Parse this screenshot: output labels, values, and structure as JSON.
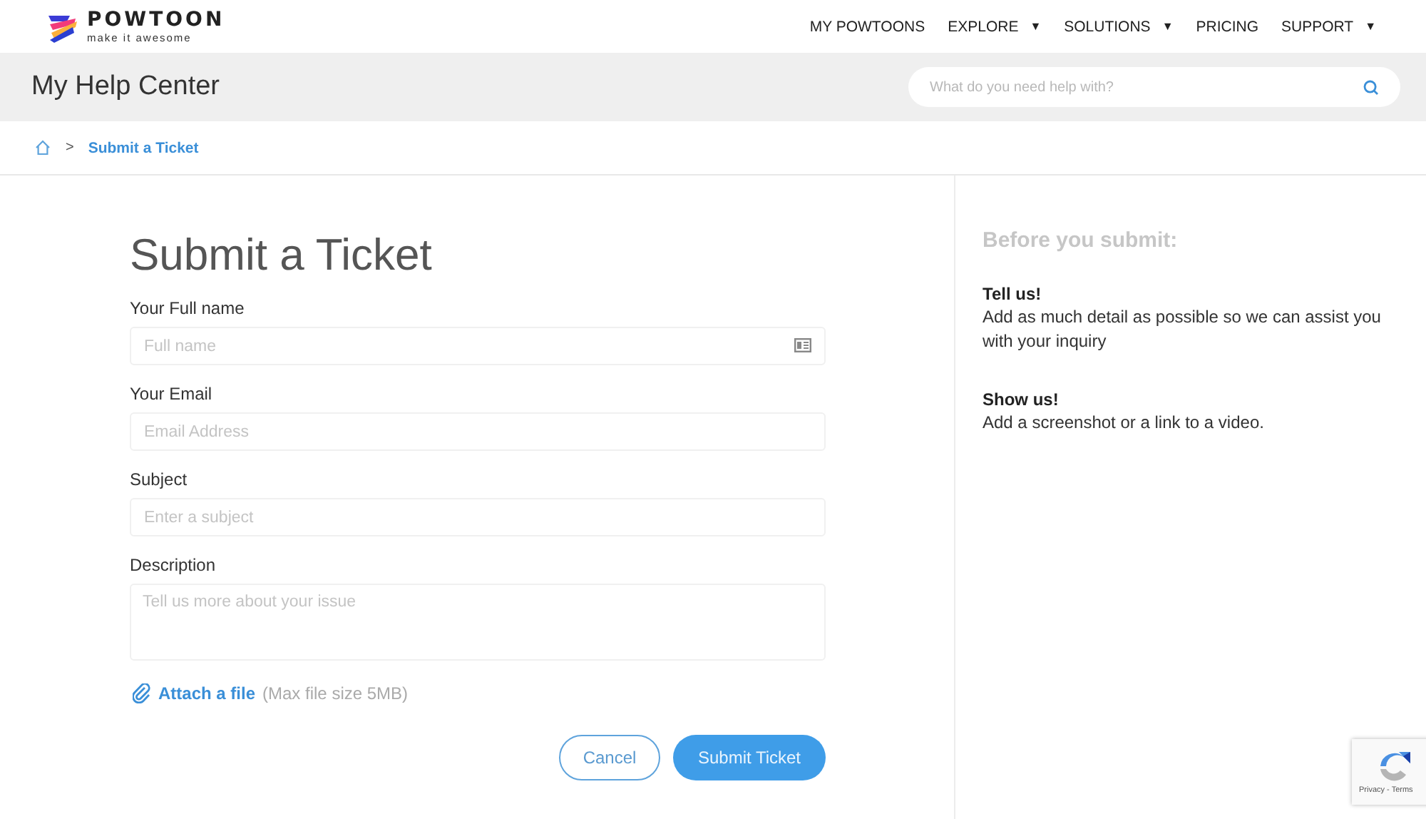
{
  "logo": {
    "name": "POWTOON",
    "tagline": "make it awesome"
  },
  "nav": [
    {
      "label": "MY POWTOONS",
      "dropdown": false
    },
    {
      "label": "EXPLORE",
      "dropdown": true
    },
    {
      "label": "SOLUTIONS",
      "dropdown": true
    },
    {
      "label": "PRICING",
      "dropdown": false
    },
    {
      "label": "SUPPORT",
      "dropdown": true
    }
  ],
  "caret": "▼",
  "help_title": "My Help Center",
  "search": {
    "placeholder": "What do you need help with?"
  },
  "breadcrumb": {
    "separator": ">",
    "current": "Submit a Ticket"
  },
  "form": {
    "title": "Submit a Ticket",
    "fields": [
      {
        "kind": "card-input",
        "label": "Your Full name",
        "placeholder": "Full name"
      },
      {
        "kind": "input",
        "label": "Your Email",
        "placeholder": "Email Address"
      },
      {
        "kind": "input",
        "label": "Subject",
        "placeholder": "Enter a subject"
      },
      {
        "kind": "textarea",
        "label": "Description",
        "placeholder": "Tell us more about your issue"
      }
    ],
    "attach": {
      "link": "Attach a file",
      "note": "(Max file size 5MB)"
    },
    "buttons": [
      {
        "kind": "secondary",
        "label": "Cancel"
      },
      {
        "kind": "primary",
        "label": "Submit Ticket"
      }
    ]
  },
  "aside": {
    "title": "Before you submit:",
    "tips": [
      {
        "heading": "Tell us!",
        "text": "Add as much detail as possible so we can assist you with your inquiry"
      },
      {
        "heading": "Show us!",
        "text": "Add a screenshot or a link to a video."
      }
    ]
  },
  "recaptcha": {
    "links": "Privacy - Terms"
  }
}
